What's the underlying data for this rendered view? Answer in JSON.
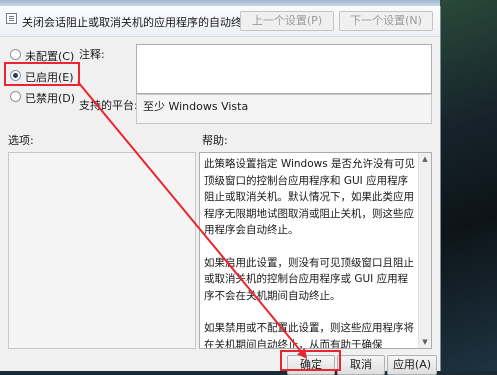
{
  "policy_title": "关闭会话阻止或取消关机的应用程序的自动终止功能",
  "nav": {
    "prev": "上一个设置(P)",
    "next": "下一个设置(N)"
  },
  "options_state": [
    {
      "label": "未配置(C)",
      "checked": false
    },
    {
      "label": "已启用(E)",
      "checked": true
    },
    {
      "label": "已禁用(D)",
      "checked": false
    }
  ],
  "comment_label": "注释:",
  "platform_label": "支持的平台:",
  "platform_value": "至少 Windows Vista",
  "options_label": "选项:",
  "help_label": "帮助:",
  "help_paragraphs": [
    "此策略设置指定 Windows 是否允许没有可见顶级窗口的控制台应用程序和 GUI 应用程序阻止或取消关机。默认情况下，如果此类应用程序无限期地试图取消或阻止关机，则这些应用程序会自动终止。",
    "如果启用此设置，则没有可见顶级窗口且阻止或取消关机的控制台应用程序或 GUI 应用程序不会在关机期间自动终止。",
    "如果禁用或不配置此设置，则这些应用程序将在关机期间自动终止，从而有助于确保 Windows 可以更快速、更顺利地关机。"
  ],
  "buttons": {
    "ok": "确定",
    "cancel": "取消",
    "apply": "应用(A)"
  },
  "colors": {
    "highlight": "#e8262f",
    "dialog_bg": "#f0f0f0"
  }
}
